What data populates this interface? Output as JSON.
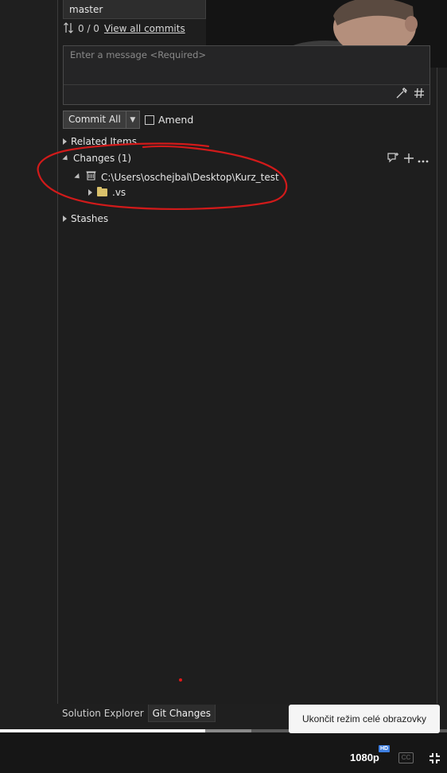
{
  "git_panel": {
    "branch": "master",
    "sync_counts": "0 / 0",
    "view_all_commits": "View all commits",
    "message_placeholder": "Enter a message <Required>",
    "commit_label": "Commit All",
    "amend_label": "Amend",
    "sections": {
      "related": "Related Items",
      "changes": "Changes (1)",
      "stashes": "Stashes"
    },
    "repo_path": "C:\\Users\\oschejbal\\Desktop\\Kurz_test",
    "folder_name": ".vs"
  },
  "bottom_tabs": [
    {
      "label": "Solution Explorer",
      "active": false
    },
    {
      "label": "Git Changes",
      "active": true
    }
  ],
  "video_player": {
    "tooltip": "Ukončit režim celé obrazovky",
    "quality": "1080p",
    "hd_badge": "HD",
    "cc_label": "CC",
    "progress": 0.46
  },
  "colors": {
    "annotation_red": "#d11a1a",
    "accent_hd": "#3d7ee0"
  }
}
